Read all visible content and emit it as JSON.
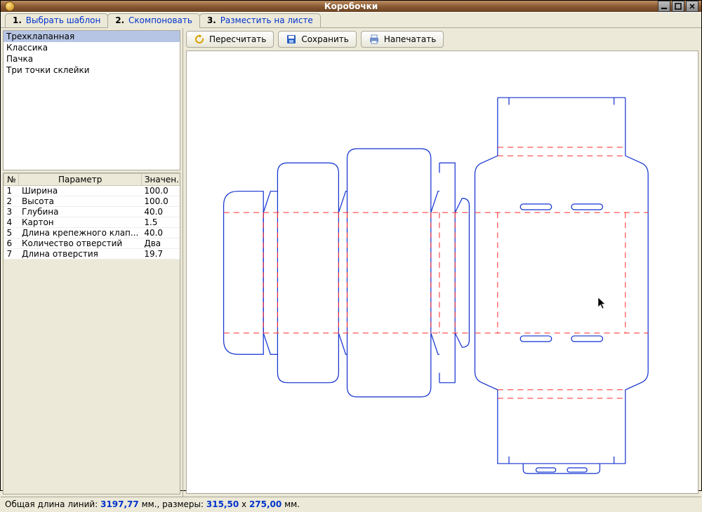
{
  "window": {
    "title": "Коробочки"
  },
  "tabs": [
    {
      "num": "1.",
      "label": "Выбрать шаблон"
    },
    {
      "num": "2.",
      "label": "Скомпоновать"
    },
    {
      "num": "3.",
      "label": "Разместить на листе"
    }
  ],
  "templates": {
    "items": [
      "Трехклапанная",
      "Классика",
      "Пачка",
      "Три точки склейки"
    ],
    "selected_index": 0
  },
  "param_table": {
    "headers": {
      "num": "№",
      "name": "Параметр",
      "value": "Значен..."
    },
    "rows": [
      {
        "n": "1",
        "name": "Ширина",
        "value": "100.0"
      },
      {
        "n": "2",
        "name": "Высота",
        "value": "100.0"
      },
      {
        "n": "3",
        "name": "Глубина",
        "value": "40.0"
      },
      {
        "n": "4",
        "name": "Картон",
        "value": "1.5"
      },
      {
        "n": "5",
        "name": "Длина крепежного клап...",
        "value": "40.0"
      },
      {
        "n": "6",
        "name": "Количество отверстий",
        "value": "Два"
      },
      {
        "n": "7",
        "name": "Длина отверстия",
        "value": "19.7"
      }
    ]
  },
  "toolbar": {
    "recalculate": "Пересчитать",
    "save": "Сохранить",
    "print": "Напечатать"
  },
  "status": {
    "prefix": "Общая длина линий: ",
    "length": "3197,77",
    "mid1": " мм., размеры: ",
    "w": "315,50",
    "x": " x ",
    "h": "275,00",
    "suffix": " мм."
  }
}
